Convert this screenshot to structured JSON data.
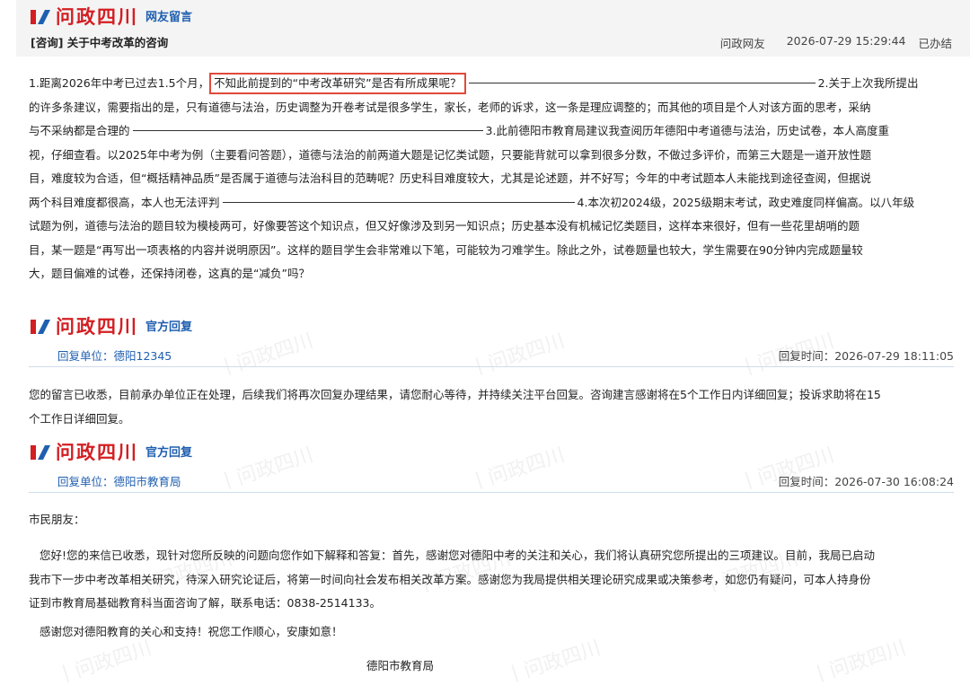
{
  "header": {
    "logo_text": "问政四川",
    "section": "网友留言",
    "subject_tag": "[咨询]",
    "subject": "关于中考改革的咨询",
    "author": "问政网友",
    "datetime": "2026-07-29 15:29:44",
    "status": "已办结"
  },
  "message": {
    "line1_before": "1.距离2026年中考已过去1.5个月，",
    "line1_highlight": "不知此前提到的“中考改革研究”是否有所成果呢？",
    "line1_after": "2.关于上次我所提出",
    "line2": "的许多条建议，需要指出的是，只有道德与法治，历史调整为开卷考试是很多学生，家长，老师的诉求，这一条是理应调整的；而其他的项目是个人对该方面的思考，采纳",
    "line3_before": "与不采纳都是合理的",
    "line3_after": "3.此前德阳市教育局建议我查阅历年德阳中考道德与法治，历史试卷，本人高度重",
    "line4": "视，仔细查看。以2025年中考为例（主要看问答题），道德与法治的前两道大题是记忆类试题，只要能背就可以拿到很多分数，不做过多评价，而第三大题是一道开放性题",
    "line5": "目，难度较为合适，但“概括精神品质”是否属于道德与法治科目的范畴呢？历史科目难度较大，尤其是论述题，并不好写；今年的中考试题本人未能找到途径查阅，但据说",
    "line6_before": "两个科目难度都很高，本人也无法评判",
    "line6_after": "4.本次初2024级，2025级期末考试，政史难度同样偏高。以八年级",
    "line7": "试题为例，道德与法治的题目较为模棱两可，好像要答这个知识点，但又好像涉及到另一知识点；历史基本没有机械记忆类题目，这样本来很好，但有一些花里胡哨的题",
    "line8": "目，某一题是“再写出一项表格的内容并说明原因”。这样的题目学生会非常难以下笔，可能较为刁难学生。除此之外，试卷题量也较大，学生需要在90分钟内完成题量较",
    "line9": "大，题目偏难的试卷，还保持闭卷，这真的是“减负”吗？"
  },
  "reply1": {
    "logo_text": "问政四川",
    "section": "官方回复",
    "unit": "回复单位：德阳12345",
    "time": "回复时间：2026-07-29 18:11:05",
    "line1": "您的留言已收悉，目前承办单位正在处理，后续我们将再次回复办理结果，请您耐心等待，并持续关注平台回复。咨询建言感谢将在5个工作日内详细回复；投诉求助将在15",
    "line2": "个工作日详细回复。"
  },
  "reply2": {
    "logo_text": "问政四川",
    "section": "官方回复",
    "unit": "回复单位：德阳市教育局",
    "time": "回复时间：2026-07-30 16:08:24",
    "greeting": "市民朋友：",
    "body1": "您好!您的来信已收悉，现针对您所反映的问题向您作如下解释和答复：首先，感谢您对德阳中考的关注和关心，我们将认真研究您所提出的三项建议。目前，我局已启动",
    "body2": "我市下一步中考改革相关研究，待深入研究论证后，将第一时间向社会发布相关改革方案。感谢您为我局提供相关理论研究成果或决策参考，如您仍有疑问，可本人持身份",
    "body3": "证到市教育局基础教育科当面咨询了解，联系电话：0838-2514133。",
    "closing": "感谢您对德阳教育的关心和支持！祝您工作顺心，安康如意！",
    "signature": "德阳市教育局"
  },
  "colors": {
    "brand_red": "#d31e22",
    "link_blue": "#1f5fb0",
    "highlight_box": "#e0493a"
  }
}
